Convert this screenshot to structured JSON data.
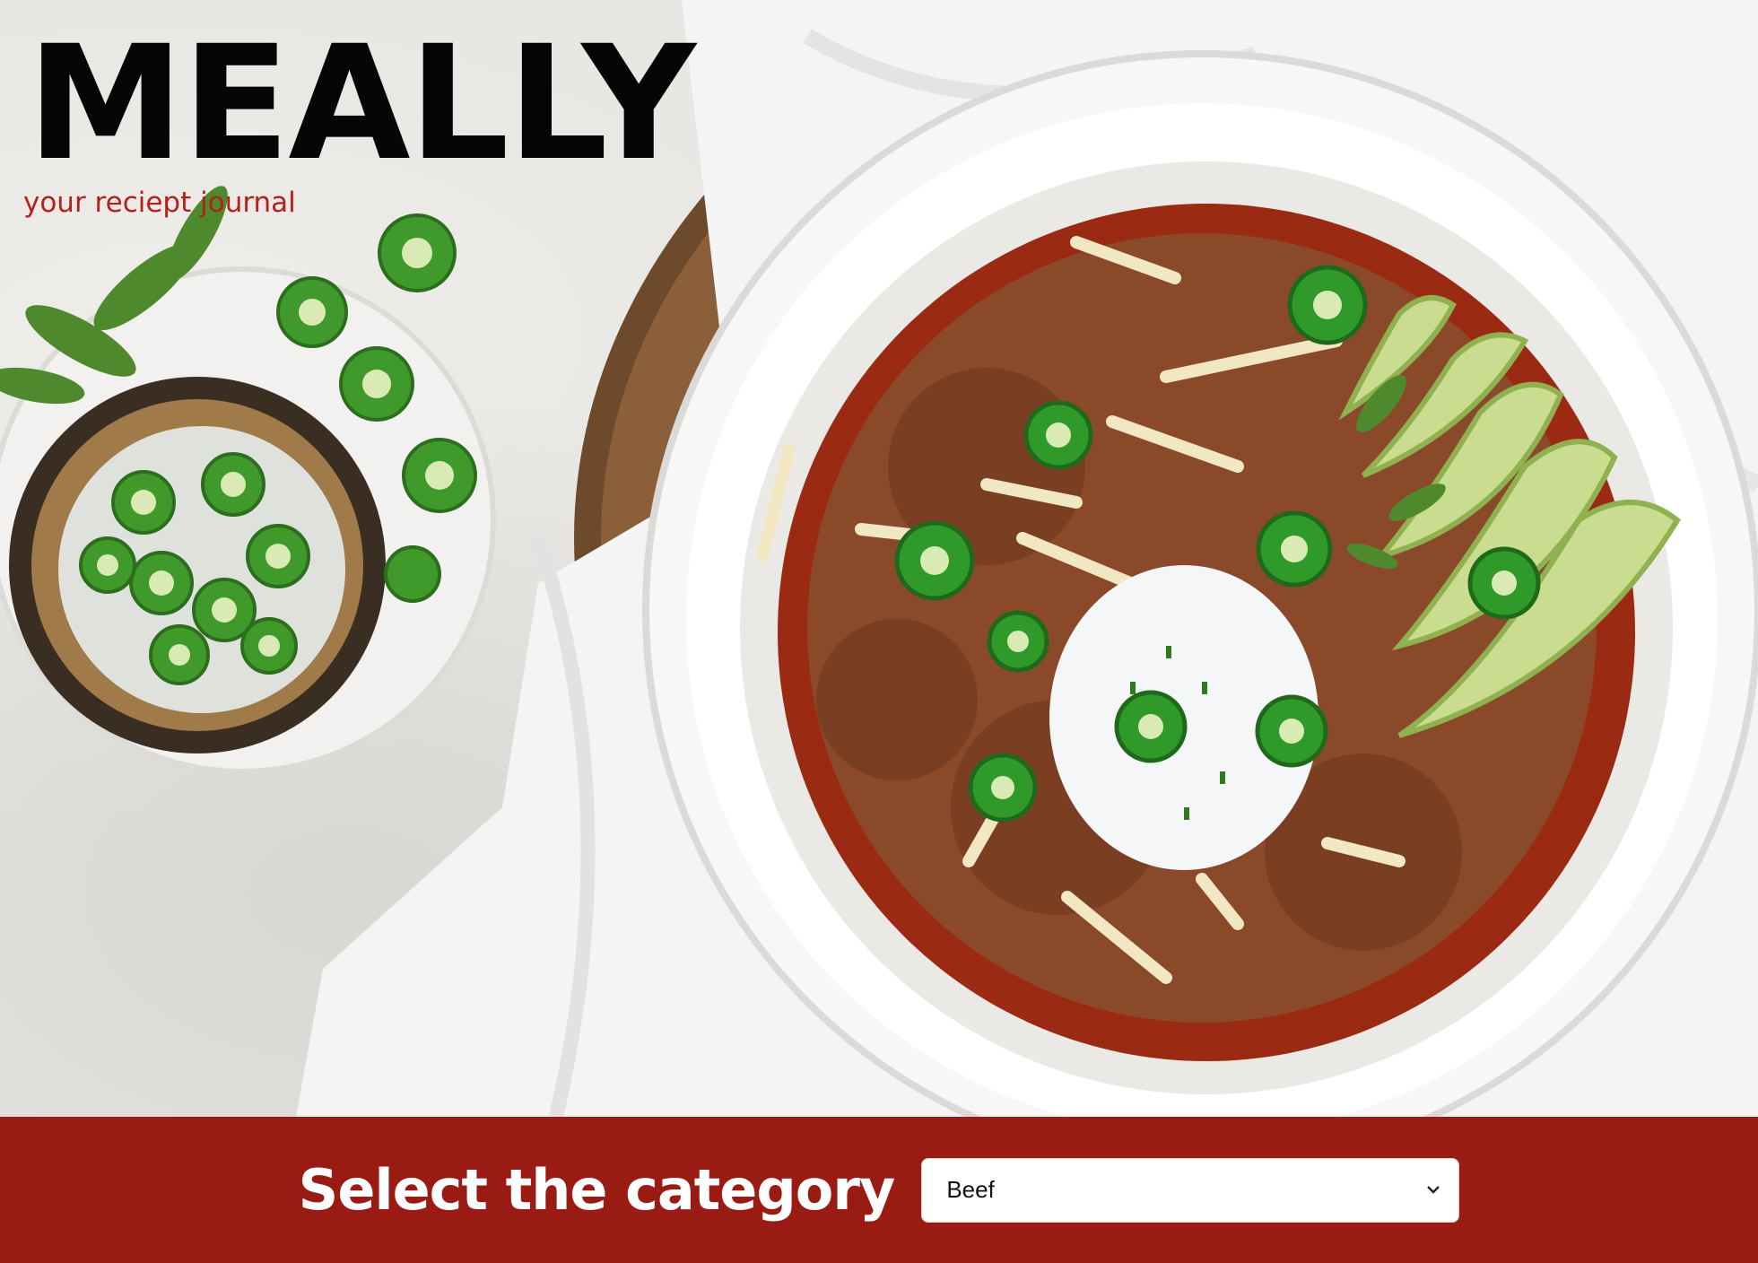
{
  "brand": {
    "title": "MEALLY",
    "tagline": "your reciept journal"
  },
  "category_bar": {
    "label": "Select the category",
    "select": {
      "selected": "Beef",
      "icon": "chevron-down-icon"
    }
  },
  "colors": {
    "brand_red": "#9a1b13",
    "tagline_red": "#b3221a",
    "title_black": "#050505"
  }
}
